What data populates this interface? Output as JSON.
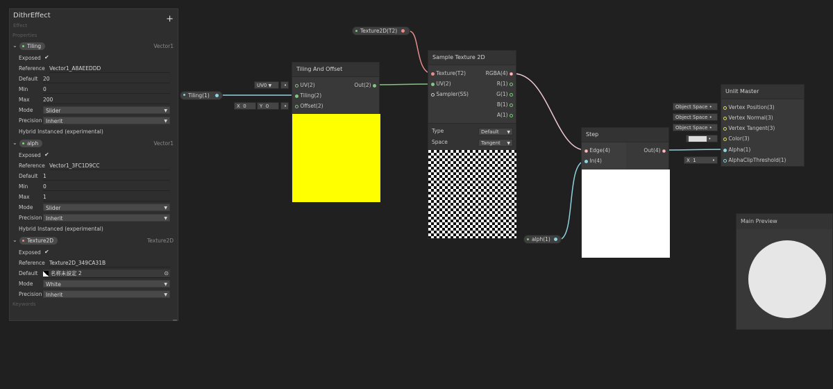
{
  "blackboard": {
    "title": "DithrEffect",
    "subtitle": "Effect",
    "add_label": "+",
    "properties_label": "Properties",
    "keywords_label": "Keywords",
    "props": [
      {
        "name": "Tiling",
        "type": "Vector1",
        "rows": {
          "exposed_label": "Exposed",
          "exposed": "✔",
          "reference_label": "Reference",
          "reference": "Vector1_A8AEEDDD",
          "default_label": "Default",
          "default": "20",
          "min_label": "Min",
          "min": "0",
          "max_label": "Max",
          "max": "200",
          "mode_label": "Mode",
          "mode": "Slider",
          "precision_label": "Precision",
          "precision": "Inherit",
          "hybrid_label": "Hybrid Instanced (experimental)"
        }
      },
      {
        "name": "alph",
        "type": "Vector1",
        "rows": {
          "exposed_label": "Exposed",
          "exposed": "✔",
          "reference_label": "Reference",
          "reference": "Vector1_3FC1D9CC",
          "default_label": "Default",
          "default": "1",
          "min_label": "Min",
          "min": "0",
          "max_label": "Max",
          "max": "1",
          "mode_label": "Mode",
          "mode": "Slider",
          "precision_label": "Precision",
          "precision": "Inherit",
          "hybrid_label": "Hybrid Instanced (experimental)"
        }
      },
      {
        "name": "Texture2D",
        "type": "Texture2D",
        "rows": {
          "exposed_label": "Exposed",
          "exposed": "✔",
          "reference_label": "Reference",
          "reference": "Texture2D_349CA31B",
          "default_label": "Default",
          "default": "名称未設定 2",
          "mode_label": "Mode",
          "mode": "White",
          "precision_label": "Precision",
          "precision": "Inherit"
        }
      }
    ]
  },
  "nodes": {
    "tiling_offset": {
      "title": "Tiling And Offset",
      "inputs": [
        "UV(2)",
        "Tiling(2)",
        "Offset(2)"
      ],
      "output": "Out(2)",
      "uv_dropdown": "UV0",
      "offset_x_label": "X",
      "offset_x": "0",
      "offset_y_label": "Y",
      "offset_y": "0"
    },
    "sample_texture": {
      "title": "Sample Texture 2D",
      "inputs": [
        "Texture(T2)",
        "UV(2)",
        "Sampler(SS)"
      ],
      "outputs": [
        "RGBA(4)",
        "R(1)",
        "G(1)",
        "B(1)",
        "A(1)"
      ],
      "type_label": "Type",
      "type_value": "Default",
      "space_label": "Space",
      "space_value": "Tangent"
    },
    "step": {
      "title": "Step",
      "inputs": [
        "Edge(4)",
        "In(4)"
      ],
      "output": "Out(4)"
    },
    "unlit_master": {
      "title": "Unlit Master",
      "inputs": [
        "Vertex Position(3)",
        "Vertex Normal(3)",
        "Vertex Tangent(3)",
        "Color(3)",
        "Alpha(1)",
        "AlphaClipThreshold(1)"
      ],
      "space_labels": [
        "Object Space",
        "Object Space",
        "Object Space"
      ],
      "clip_x_label": "X",
      "clip_x": "1"
    },
    "property_nodes": {
      "tiling": "Tiling(1)",
      "texture": "Texture2D(T2)",
      "alph": "alph(1)"
    }
  },
  "main_preview": {
    "title": "Main Preview"
  },
  "colors": {
    "background": "#202020",
    "wire_vector": "#7ec97e",
    "wire_texture": "#e58c8c",
    "wire_float": "#8fd3e0",
    "wire_rgba": "#f0c8d8",
    "preview_yellow": "#ffff00"
  }
}
